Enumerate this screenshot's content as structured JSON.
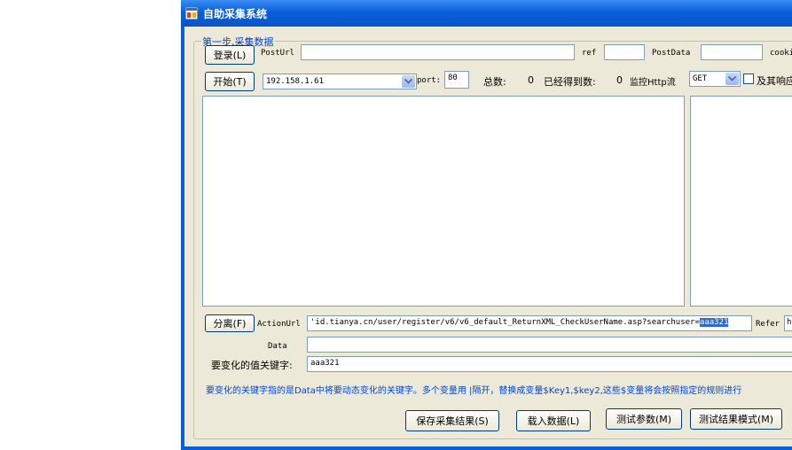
{
  "window": {
    "title": "自助采集系统"
  },
  "group": {
    "title": "第一步,采集数据"
  },
  "row1": {
    "login_button": "登录(L)",
    "posturl_label": "PostUrl",
    "posturl_value": "",
    "ref_label": "ref",
    "ref_value": "",
    "postdata_label": "PostData",
    "postdata_value": "",
    "cookie_label": "cooki"
  },
  "row2": {
    "start_button": "开始(T)",
    "ip_value": "192.158.1.61",
    "port_label": "port:",
    "port_value": "80",
    "total_label": "总数:",
    "total_value": "0",
    "got_label": "已经得到数:",
    "got_value": "0",
    "monitor_label": "监控Http流",
    "method_value": "GET",
    "response_label": "及其响应"
  },
  "row3": {
    "split_button": "分离(F)",
    "actionurl_label": "ActionUrl",
    "actionurl_prefix": "'id.tianya.cn/user/register/v6/v6_default_ReturnXML_CheckUserName.asp?searchuser=",
    "actionurl_selected": "aaa321",
    "refer_label": "Refer",
    "refer_value": "h"
  },
  "row4": {
    "data_label": "Data",
    "data_value": ""
  },
  "row5": {
    "keyword_label": "要变化的值关键字:",
    "keyword_value": "aaa321"
  },
  "note": "要变化的关键字指的是Data中将要动态变化的关键字。多个变量用 |隔开，替换成变量$Key1,$key2,这些$变量将会按照指定的规则进行",
  "bottom": {
    "save_button": "保存采集结果(S)",
    "load_button": "载入数据(L)",
    "test_params_button": "测试参数(M)",
    "test_mode_button": "测试结果模式(M)"
  }
}
